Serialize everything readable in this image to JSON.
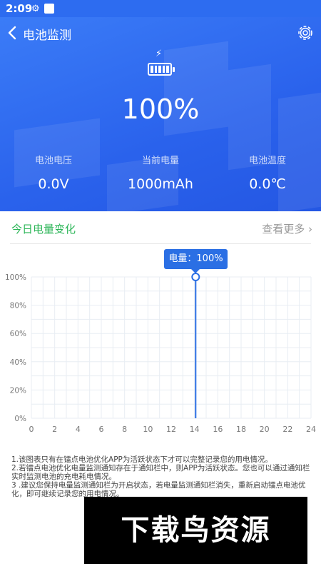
{
  "status_bar": {
    "time": "2:09"
  },
  "header": {
    "title": "电池监测"
  },
  "battery": {
    "percent": "100%",
    "level": 1.0
  },
  "stats": [
    {
      "label": "电池电压",
      "value": "0.0V"
    },
    {
      "label": "当前电量",
      "value": "1000mAh"
    },
    {
      "label": "电池温度",
      "value": "0.0℃"
    }
  ],
  "section": {
    "title": "今日电量变化",
    "more": "查看更多"
  },
  "tooltip": "电量：100%",
  "chart_data": {
    "type": "line",
    "x_ticks": [
      "0",
      "2",
      "4",
      "6",
      "8",
      "10",
      "12",
      "14",
      "16",
      "18",
      "20",
      "22",
      "24"
    ],
    "y_ticks": [
      "0%",
      "20%",
      "40%",
      "60%",
      "80%",
      "100%"
    ],
    "xlim": [
      0,
      24
    ],
    "ylim": [
      0,
      100
    ],
    "grid": true,
    "series": [
      {
        "points": [
          [
            14.1,
            0
          ],
          [
            14.1,
            83
          ],
          [
            14.1,
            100
          ]
        ]
      }
    ],
    "highlight": {
      "x": 14.1,
      "y": 100
    }
  },
  "notes": [
    "1.该图表只有在镭点电池优化APP为活跃状态下才可以完整记录您的用电情况。",
    "2.若镭点电池优化电量监测通知存在于通知栏中，则APP为活跃状态。您也可以通过通知栏实时监测电池的充电耗电情况。",
    "3 .建议您保持电量监测通知栏为开启状态，若电量监测通知栏消失，重新启动镭点电池优化，即可继续记录您的用电情况。"
  ],
  "watermark": "下载鸟资源",
  "colors": {
    "primary": "#2d6cf0",
    "accent_green": "#2bb557",
    "line": "#2b6fe4"
  }
}
